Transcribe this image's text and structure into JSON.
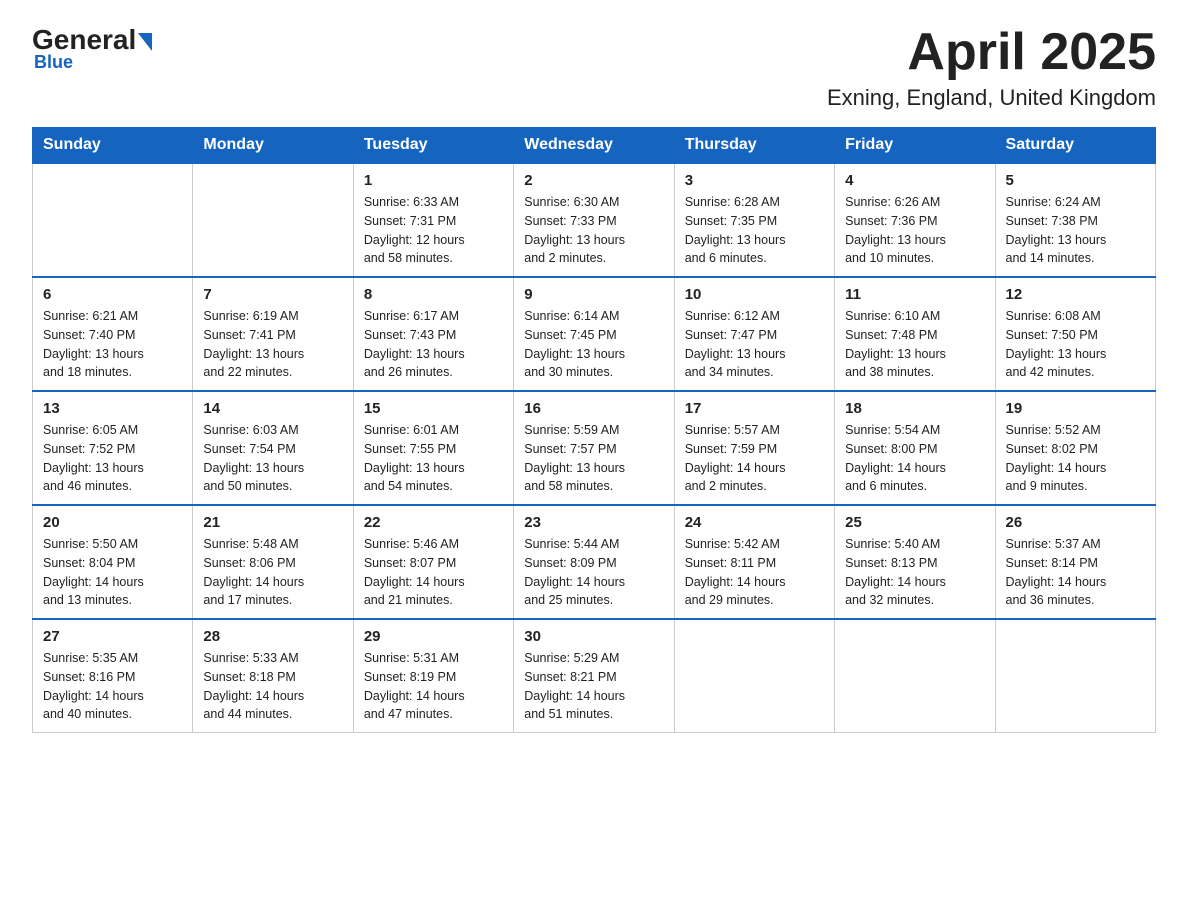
{
  "logo": {
    "general": "General",
    "blue": "Blue"
  },
  "title": "April 2025",
  "subtitle": "Exning, England, United Kingdom",
  "days_of_week": [
    "Sunday",
    "Monday",
    "Tuesday",
    "Wednesday",
    "Thursday",
    "Friday",
    "Saturday"
  ],
  "weeks": [
    [
      {
        "day": "",
        "info": ""
      },
      {
        "day": "",
        "info": ""
      },
      {
        "day": "1",
        "info": "Sunrise: 6:33 AM\nSunset: 7:31 PM\nDaylight: 12 hours\nand 58 minutes."
      },
      {
        "day": "2",
        "info": "Sunrise: 6:30 AM\nSunset: 7:33 PM\nDaylight: 13 hours\nand 2 minutes."
      },
      {
        "day": "3",
        "info": "Sunrise: 6:28 AM\nSunset: 7:35 PM\nDaylight: 13 hours\nand 6 minutes."
      },
      {
        "day": "4",
        "info": "Sunrise: 6:26 AM\nSunset: 7:36 PM\nDaylight: 13 hours\nand 10 minutes."
      },
      {
        "day": "5",
        "info": "Sunrise: 6:24 AM\nSunset: 7:38 PM\nDaylight: 13 hours\nand 14 minutes."
      }
    ],
    [
      {
        "day": "6",
        "info": "Sunrise: 6:21 AM\nSunset: 7:40 PM\nDaylight: 13 hours\nand 18 minutes."
      },
      {
        "day": "7",
        "info": "Sunrise: 6:19 AM\nSunset: 7:41 PM\nDaylight: 13 hours\nand 22 minutes."
      },
      {
        "day": "8",
        "info": "Sunrise: 6:17 AM\nSunset: 7:43 PM\nDaylight: 13 hours\nand 26 minutes."
      },
      {
        "day": "9",
        "info": "Sunrise: 6:14 AM\nSunset: 7:45 PM\nDaylight: 13 hours\nand 30 minutes."
      },
      {
        "day": "10",
        "info": "Sunrise: 6:12 AM\nSunset: 7:47 PM\nDaylight: 13 hours\nand 34 minutes."
      },
      {
        "day": "11",
        "info": "Sunrise: 6:10 AM\nSunset: 7:48 PM\nDaylight: 13 hours\nand 38 minutes."
      },
      {
        "day": "12",
        "info": "Sunrise: 6:08 AM\nSunset: 7:50 PM\nDaylight: 13 hours\nand 42 minutes."
      }
    ],
    [
      {
        "day": "13",
        "info": "Sunrise: 6:05 AM\nSunset: 7:52 PM\nDaylight: 13 hours\nand 46 minutes."
      },
      {
        "day": "14",
        "info": "Sunrise: 6:03 AM\nSunset: 7:54 PM\nDaylight: 13 hours\nand 50 minutes."
      },
      {
        "day": "15",
        "info": "Sunrise: 6:01 AM\nSunset: 7:55 PM\nDaylight: 13 hours\nand 54 minutes."
      },
      {
        "day": "16",
        "info": "Sunrise: 5:59 AM\nSunset: 7:57 PM\nDaylight: 13 hours\nand 58 minutes."
      },
      {
        "day": "17",
        "info": "Sunrise: 5:57 AM\nSunset: 7:59 PM\nDaylight: 14 hours\nand 2 minutes."
      },
      {
        "day": "18",
        "info": "Sunrise: 5:54 AM\nSunset: 8:00 PM\nDaylight: 14 hours\nand 6 minutes."
      },
      {
        "day": "19",
        "info": "Sunrise: 5:52 AM\nSunset: 8:02 PM\nDaylight: 14 hours\nand 9 minutes."
      }
    ],
    [
      {
        "day": "20",
        "info": "Sunrise: 5:50 AM\nSunset: 8:04 PM\nDaylight: 14 hours\nand 13 minutes."
      },
      {
        "day": "21",
        "info": "Sunrise: 5:48 AM\nSunset: 8:06 PM\nDaylight: 14 hours\nand 17 minutes."
      },
      {
        "day": "22",
        "info": "Sunrise: 5:46 AM\nSunset: 8:07 PM\nDaylight: 14 hours\nand 21 minutes."
      },
      {
        "day": "23",
        "info": "Sunrise: 5:44 AM\nSunset: 8:09 PM\nDaylight: 14 hours\nand 25 minutes."
      },
      {
        "day": "24",
        "info": "Sunrise: 5:42 AM\nSunset: 8:11 PM\nDaylight: 14 hours\nand 29 minutes."
      },
      {
        "day": "25",
        "info": "Sunrise: 5:40 AM\nSunset: 8:13 PM\nDaylight: 14 hours\nand 32 minutes."
      },
      {
        "day": "26",
        "info": "Sunrise: 5:37 AM\nSunset: 8:14 PM\nDaylight: 14 hours\nand 36 minutes."
      }
    ],
    [
      {
        "day": "27",
        "info": "Sunrise: 5:35 AM\nSunset: 8:16 PM\nDaylight: 14 hours\nand 40 minutes."
      },
      {
        "day": "28",
        "info": "Sunrise: 5:33 AM\nSunset: 8:18 PM\nDaylight: 14 hours\nand 44 minutes."
      },
      {
        "day": "29",
        "info": "Sunrise: 5:31 AM\nSunset: 8:19 PM\nDaylight: 14 hours\nand 47 minutes."
      },
      {
        "day": "30",
        "info": "Sunrise: 5:29 AM\nSunset: 8:21 PM\nDaylight: 14 hours\nand 51 minutes."
      },
      {
        "day": "",
        "info": ""
      },
      {
        "day": "",
        "info": ""
      },
      {
        "day": "",
        "info": ""
      }
    ]
  ]
}
